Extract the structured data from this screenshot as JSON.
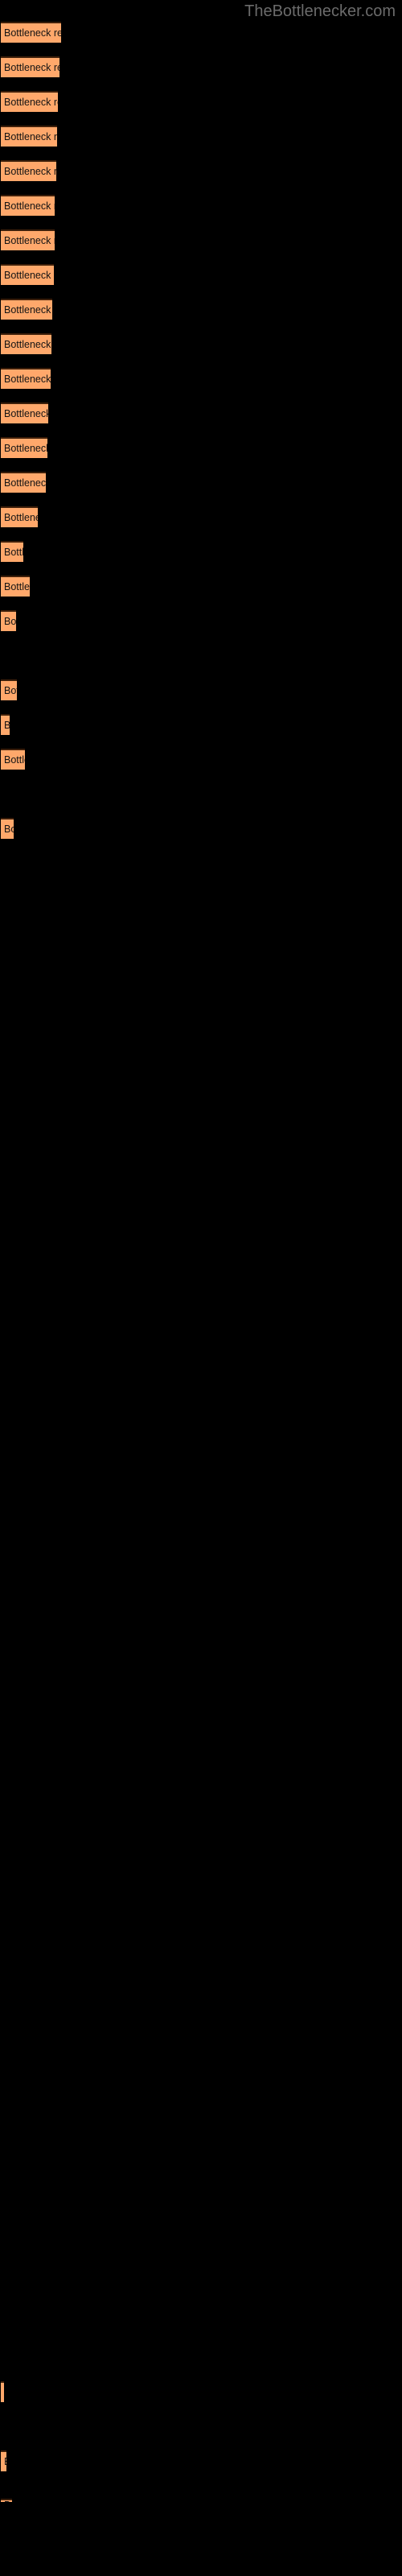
{
  "header": {
    "site_title": "TheBottlenecker.com",
    "title_color": "#6b6b6b"
  },
  "theme": {
    "background": "#000000",
    "bar_fill": "#ffa86b",
    "bar_border_top": "#3d1f0a",
    "label_color": "#141414"
  },
  "chart_data": {
    "type": "bar",
    "orientation": "horizontal",
    "title": "",
    "subtitle": "",
    "xlabel": "",
    "ylabel": "",
    "grid": false,
    "legend": null,
    "axis_visible": false,
    "bar_label_text": "Bottleneck result",
    "categories": [
      "Bottleneck result",
      "Bottleneck result",
      "Bottleneck result",
      "Bottleneck result",
      "Bottleneck result",
      "Bottleneck result",
      "Bottleneck result",
      "Bottleneck result",
      "Bottleneck result",
      "Bottleneck result",
      "Bottleneck result",
      "Bottleneck result",
      "Bottleneck result",
      "Bottleneck result",
      "Bottleneck result",
      "Bottleneck result",
      "Bottleneck result",
      "Bottleneck result",
      "Bottleneck result",
      "Bottleneck result",
      "Bottleneck result",
      "Bottleneck result",
      "Bottleneck result",
      "Bottleneck result",
      "Bottleneck result"
    ],
    "values": [
      75,
      73,
      71,
      69,
      67,
      65,
      63,
      61,
      59,
      57,
      55,
      53,
      51,
      49,
      47,
      43,
      38,
      35,
      25,
      21,
      17,
      10,
      4,
      8,
      5
    ],
    "xlim": [
      0,
      500
    ],
    "bars": [
      {
        "y": 27,
        "height": 26,
        "width": 75,
        "label": "Bottleneck result"
      },
      {
        "y": 70,
        "height": 26,
        "width": 73,
        "label": "Bottleneck result"
      },
      {
        "y": 113,
        "height": 26,
        "width": 71,
        "label": "Bottleneck result"
      },
      {
        "y": 156,
        "height": 26,
        "width": 70,
        "label": "Bottleneck result"
      },
      {
        "y": 199,
        "height": 26,
        "width": 69,
        "label": "Bottleneck result"
      },
      {
        "y": 242,
        "height": 26,
        "width": 67,
        "label": "Bottleneck result"
      },
      {
        "y": 285,
        "height": 26,
        "width": 67,
        "label": "Bottleneck result"
      },
      {
        "y": 328,
        "height": 26,
        "width": 66,
        "label": "Bottleneck result"
      },
      {
        "y": 371,
        "height": 26,
        "width": 64,
        "label": "Bottleneck result"
      },
      {
        "y": 414,
        "height": 26,
        "width": 63,
        "label": "Bottleneck result"
      },
      {
        "y": 457,
        "height": 26,
        "width": 62,
        "label": "Bottleneck result"
      },
      {
        "y": 500,
        "height": 26,
        "width": 59,
        "label": "Bottleneck result"
      },
      {
        "y": 543,
        "height": 26,
        "width": 58,
        "label": "Bottleneck result"
      },
      {
        "y": 586,
        "height": 26,
        "width": 56,
        "label": "Bottleneck result"
      },
      {
        "y": 629,
        "height": 26,
        "width": 46,
        "label": "Bottleneck result"
      },
      {
        "y": 672,
        "height": 26,
        "width": 28,
        "label": "Bottleneck result"
      },
      {
        "y": 715,
        "height": 26,
        "width": 36,
        "label": "Bottleneck result"
      },
      {
        "y": 758,
        "height": 26,
        "width": 19,
        "label": "Bottleneck result"
      },
      {
        "y": 844,
        "height": 26,
        "width": 20,
        "label": "Bottleneck result"
      },
      {
        "y": 887,
        "height": 26,
        "width": 11,
        "label": "Bottleneck result"
      },
      {
        "y": 930,
        "height": 26,
        "width": 30,
        "label": "Bottleneck result"
      },
      {
        "y": 1016,
        "height": 26,
        "width": 16,
        "label": "Bottleneck result"
      },
      {
        "y": 2958,
        "height": 26,
        "width": 4,
        "label": "Bottleneck result"
      },
      {
        "y": 3044,
        "height": 26,
        "width": 7,
        "label": "Bottleneck result"
      },
      {
        "y": 3104,
        "height": 4,
        "width": 14,
        "label": "Bottleneck result"
      }
    ]
  }
}
